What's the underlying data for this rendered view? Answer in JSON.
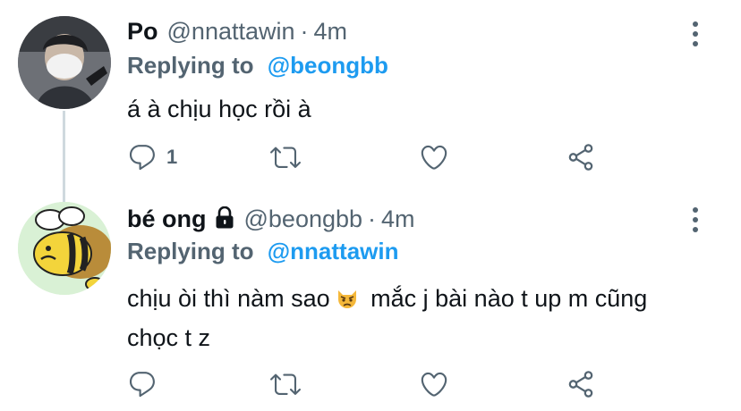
{
  "tweets": [
    {
      "name": "Po",
      "handle": "@nnattawin",
      "separator": "·",
      "time": "4m",
      "replying_label": "Replying to",
      "replying_to": "@beongbb",
      "text": "á à chịu học rồi à",
      "reply_count": "1",
      "protected": false
    },
    {
      "name": "bé ong",
      "handle": "@beongbb",
      "separator": "·",
      "time": "4m",
      "replying_label": "Replying to",
      "replying_to": "@nnattawin",
      "text_before_emoji": "chịu òi thì nàm sao",
      "text_after_emoji": " mắc j bài nào t up m cũng chọc t z",
      "emoji": "angry-cat-face",
      "reply_count": "",
      "protected": true
    }
  ],
  "icons": [
    "more-icon",
    "reply-icon",
    "retweet-icon",
    "like-icon",
    "share-icon",
    "lock-icon"
  ],
  "colors": {
    "name": "#0f1419",
    "secondary": "#536471",
    "mention": "#1d9bf0",
    "thread_line": "#cfd9de"
  }
}
